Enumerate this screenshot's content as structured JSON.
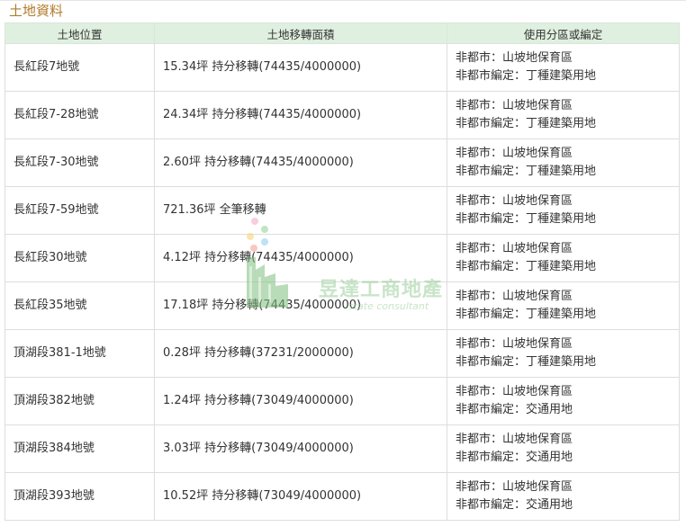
{
  "section_title": "土地資料",
  "table": {
    "headers": [
      "土地位置",
      "土地移轉面積",
      "使用分區或編定"
    ],
    "rows": [
      {
        "location": "長紅段7地號",
        "area": "15.34坪 持分移轉(74435/4000000)",
        "zone_1": "非都市：山坡地保育區",
        "zone_2": "非都市編定：丁種建築用地"
      },
      {
        "location": "長紅段7-28地號",
        "area": "24.34坪 持分移轉(74435/4000000)",
        "zone_1": "非都市：山坡地保育區",
        "zone_2": "非都市編定：丁種建築用地"
      },
      {
        "location": "長紅段7-30地號",
        "area": "2.60坪 持分移轉(74435/4000000)",
        "zone_1": "非都市：山坡地保育區",
        "zone_2": "非都市編定：丁種建築用地"
      },
      {
        "location": "長紅段7-59地號",
        "area": "721.36坪 全筆移轉",
        "zone_1": "非都市：山坡地保育區",
        "zone_2": "非都市編定：丁種建築用地"
      },
      {
        "location": "長紅段30地號",
        "area": "4.12坪 持分移轉(74435/4000000)",
        "zone_1": "非都市：山坡地保育區",
        "zone_2": "非都市編定：丁種建築用地"
      },
      {
        "location": "長紅段35地號",
        "area": "17.18坪 持分移轉(74435/4000000)",
        "zone_1": "非都市：山坡地保育區",
        "zone_2": "非都市編定：丁種建築用地"
      },
      {
        "location": "頂湖段381-1地號",
        "area": "0.28坪 持分移轉(37231/2000000)",
        "zone_1": "非都市：山坡地保育區",
        "zone_2": "非都市編定：丁種建築用地"
      },
      {
        "location": "頂湖段382地號",
        "area": "1.24坪 持分移轉(73049/4000000)",
        "zone_1": "非都市：山坡地保育區",
        "zone_2": "非都市編定：交通用地"
      },
      {
        "location": "頂湖段384地號",
        "area": "3.03坪 持分移轉(73049/4000000)",
        "zone_1": "非都市：山坡地保育區",
        "zone_2": "非都市編定：交通用地"
      },
      {
        "location": "頂湖段393地號",
        "area": "10.52坪 持分移轉(73049/4000000)",
        "zone_1": "非都市：山坡地保育區",
        "zone_2": "非都市編定：交通用地"
      }
    ]
  },
  "watermark": {
    "name": "昱達工商地產",
    "tagline": "state consultant"
  },
  "colors": {
    "title": "#b07a2a",
    "header_bg": "#e0f0e0",
    "watermark": "#9ccf9c"
  }
}
